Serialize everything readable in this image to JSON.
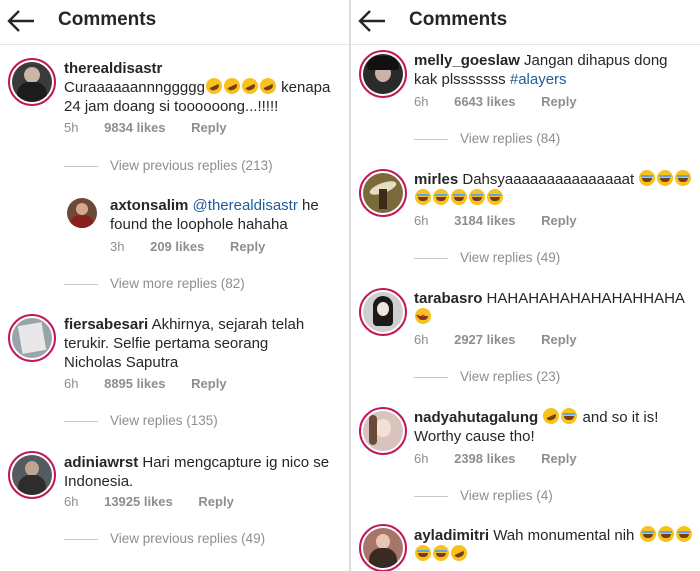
{
  "left": {
    "title": "Comments",
    "comments": [
      {
        "user": "therealdisastr",
        "text": "Curaaaaaannnggggg",
        "text2": " kenapa 24 jam doang si toooooong...!!!!!",
        "time": "5h",
        "likes": "9834 likes",
        "reply": "Reply",
        "view": "View previous replies (213)",
        "avatar_color": "#3b3b3b"
      },
      {
        "user": "axtonsalim",
        "mention": "@therealdisastr",
        "text": " he found the loophole hahaha",
        "time": "3h",
        "likes": "209 likes",
        "reply": "Reply",
        "view": "View more replies (82)",
        "avatar_color": "#6b4a3a"
      },
      {
        "user": "fiersabesari",
        "text": " Akhirnya, sejarah telah terukir. Selfie pertama seorang Nicholas Saputra",
        "time": "6h",
        "likes": "8895 likes",
        "reply": "Reply",
        "view": "View replies (135)",
        "avatar_color": "#9aa3a8"
      },
      {
        "user": "adiniawrst",
        "text": " Hari mengcapture ig nico se Indonesia.",
        "time": "6h",
        "likes": "13925 likes",
        "reply": "Reply",
        "view": "View previous replies (49)",
        "avatar_color": "#555a5e"
      }
    ]
  },
  "right": {
    "title": "Comments",
    "comments": [
      {
        "user": "melly_goeslaw",
        "text": " Jangan dihapus dong kak plsssssss ",
        "hashtag": "#alayers",
        "time": "6h",
        "likes": "6643 likes",
        "reply": "Reply",
        "view": "View replies (84)",
        "avatar_color": "#2a2a2a"
      },
      {
        "user": "mirles",
        "text": " Dahsyaaaaaaaaaaaaaaat",
        "time": "6h",
        "likes": "3184 likes",
        "reply": "Reply",
        "view": "View replies (49)",
        "avatar_color": "#7a6a3a"
      },
      {
        "user": "tarabasro",
        "text": " HAHAHAHAHAHAHAHHAHA",
        "time": "6h",
        "likes": "2927 likes",
        "reply": "Reply",
        "view": "View replies (23)",
        "avatar_color": "#cfcfcf"
      },
      {
        "user": "nadyahutagalung",
        "text": " and so it is! Worthy cause tho!",
        "time": "6h",
        "likes": "2398 likes",
        "reply": "Reply",
        "view": "View replies (4)",
        "avatar_color": "#d9c3bd"
      },
      {
        "user": "ayladimitri",
        "text": " Wah monumental nih",
        "avatar_color": "#a8756a"
      }
    ]
  },
  "colors": {
    "accent": "#c2185b",
    "link": "#1f5c99",
    "muted": "#8e8e8e"
  }
}
